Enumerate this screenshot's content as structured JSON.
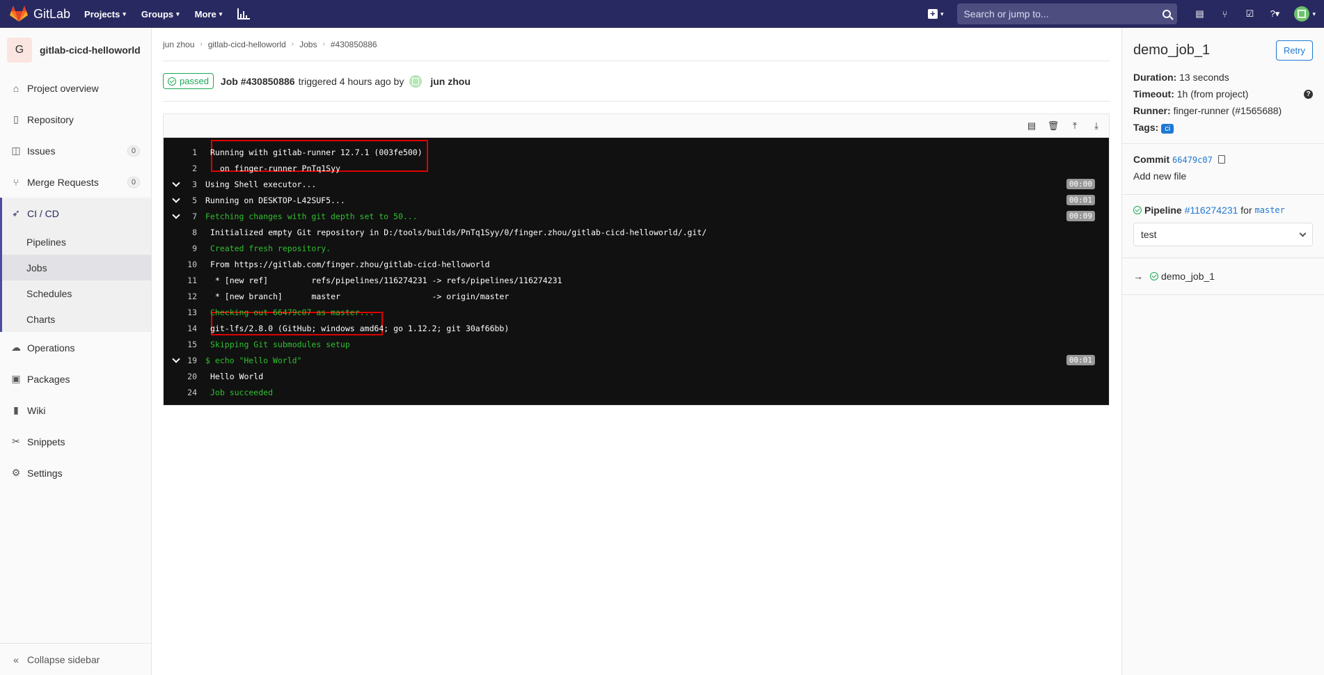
{
  "navbar": {
    "logo_text": "GitLab",
    "menu": [
      "Projects",
      "Groups",
      "More"
    ],
    "search_placeholder": "Search or jump to..."
  },
  "sidebar": {
    "project_initial": "G",
    "project_name": "gitlab-cicd-helloworld",
    "items_top": [
      {
        "label": "Project overview",
        "icon": "home-icon"
      },
      {
        "label": "Repository",
        "icon": "book-icon"
      },
      {
        "label": "Issues",
        "icon": "issues-icon",
        "badge": "0"
      },
      {
        "label": "Merge Requests",
        "icon": "merge-request-icon",
        "badge": "0"
      }
    ],
    "cicd_label": "CI / CD",
    "cicd_sub": [
      "Pipelines",
      "Jobs",
      "Schedules",
      "Charts"
    ],
    "items_bottom": [
      {
        "label": "Operations",
        "icon": "cloud-icon"
      },
      {
        "label": "Packages",
        "icon": "package-icon"
      },
      {
        "label": "Wiki",
        "icon": "wiki-icon"
      },
      {
        "label": "Snippets",
        "icon": "scissors-icon"
      },
      {
        "label": "Settings",
        "icon": "gear-icon"
      }
    ],
    "collapse_label": "Collapse sidebar"
  },
  "breadcrumb": [
    "jun zhou",
    "gitlab-cicd-helloworld",
    "Jobs",
    "#430850886"
  ],
  "job": {
    "status": "passed",
    "title": "Job #430850886",
    "meta": "triggered 4 hours ago by",
    "user": "jun zhou"
  },
  "log": [
    {
      "no": "1",
      "text": "Running with gitlab-runner 12.7.1 (003fe500)",
      "green": false,
      "chevron": false,
      "pad": true
    },
    {
      "no": "2",
      "text": "  on finger-runner PnTq1Syy",
      "green": false,
      "chevron": false,
      "pad": true
    },
    {
      "no": "3",
      "text": "Using Shell executor...",
      "green": false,
      "chevron": true,
      "duration": "00:00"
    },
    {
      "no": "5",
      "text": "Running on DESKTOP-L42SUF5...",
      "green": false,
      "chevron": true,
      "duration": "00:01"
    },
    {
      "no": "7",
      "text": "Fetching changes with git depth set to 50...",
      "green": true,
      "chevron": true,
      "duration": "00:09"
    },
    {
      "no": "8",
      "text": "Initialized empty Git repository in D:/tools/builds/PnTq1Syy/0/finger.zhou/gitlab-cicd-helloworld/.git/",
      "green": false,
      "chevron": false,
      "pad": true
    },
    {
      "no": "9",
      "text": "Created fresh repository.",
      "green": true,
      "chevron": false,
      "pad": true
    },
    {
      "no": "10",
      "text": "From https://gitlab.com/finger.zhou/gitlab-cicd-helloworld",
      "green": false,
      "chevron": false,
      "pad": true
    },
    {
      "no": "11",
      "text": " * [new ref]         refs/pipelines/116274231 -> refs/pipelines/116274231",
      "green": false,
      "chevron": false,
      "pad": true
    },
    {
      "no": "12",
      "text": " * [new branch]      master                   -> origin/master",
      "green": false,
      "chevron": false,
      "pad": true
    },
    {
      "no": "13",
      "text": "Checking out 66479c07 as master...",
      "green": true,
      "chevron": false,
      "pad": true
    },
    {
      "no": "14",
      "text": "git-lfs/2.8.0 (GitHub; windows amd64; go 1.12.2; git 30af66bb)",
      "green": false,
      "chevron": false,
      "pad": true
    },
    {
      "no": "15",
      "text": "Skipping Git submodules setup",
      "green": true,
      "chevron": false,
      "pad": true
    },
    {
      "no": "19",
      "text": "$ echo \"Hello World\"",
      "green": true,
      "chevron": true,
      "duration": "00:01"
    },
    {
      "no": "20",
      "text": "Hello World",
      "green": false,
      "chevron": false,
      "pad": true
    },
    {
      "no": "24",
      "text": "Job succeeded",
      "green": true,
      "chevron": false,
      "pad": true
    }
  ],
  "right": {
    "job_name": "demo_job_1",
    "retry_label": "Retry",
    "duration_label": "Duration:",
    "duration_value": "13 seconds",
    "timeout_label": "Timeout:",
    "timeout_value": "1h (from project)",
    "runner_label": "Runner:",
    "runner_value": "finger-runner (#1565688)",
    "tags_label": "Tags:",
    "tag": "ci",
    "commit_label": "Commit",
    "commit_sha": "66479c07",
    "commit_msg": "Add new file",
    "pipeline_label": "Pipeline",
    "pipeline_id": "#116274231",
    "pipeline_for": "for",
    "pipeline_branch": "master",
    "stage": "test",
    "job_list_item": "demo_job_1"
  },
  "colors": {
    "navbar": "#292961",
    "success": "#1aaa55",
    "link": "#1f78d1",
    "log_bg": "#111111",
    "highlight_box": "#e00000"
  }
}
